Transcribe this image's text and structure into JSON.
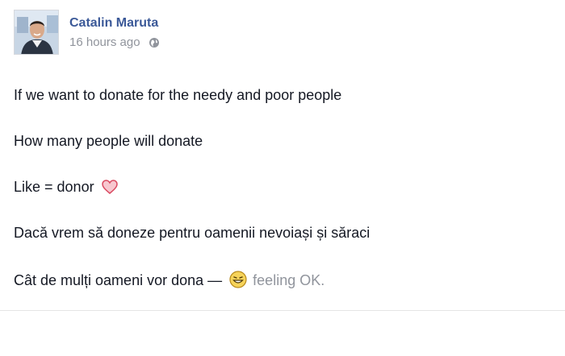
{
  "post": {
    "author": "Catalin Maruta",
    "time": "16 hours ago",
    "privacy_icon": "globe-icon",
    "lines": [
      "If we want to donate for the needy and poor people",
      "How many people will donate",
      "Like = donor",
      "Dacă vrem să doneze pentru oamenii nevoiași și săraci",
      "Cât de mulți oameni vor dona —"
    ],
    "emoji": {
      "heart": "heart-icon",
      "feeling": "smile-icon"
    },
    "feeling": "feeling OK.",
    "colors": {
      "author": "#3b5998",
      "meta": "#90949c",
      "text": "#141823"
    }
  }
}
